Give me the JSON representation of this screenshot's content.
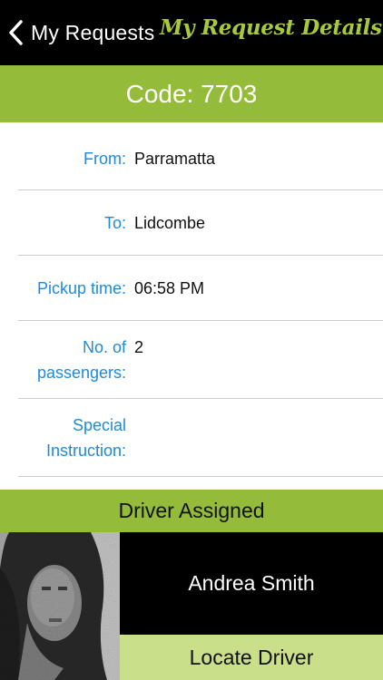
{
  "nav": {
    "back_label": "My Requests",
    "title": "My Request Details",
    "back_icon": "chevron-left-icon"
  },
  "code": {
    "text": "Code: 7703"
  },
  "details": {
    "from": {
      "label": "From:",
      "value": "Parramatta"
    },
    "to": {
      "label": "To:",
      "value": "Lidcombe"
    },
    "pickup": {
      "label": "Pickup time:",
      "value": "06:58 PM"
    },
    "passengers": {
      "label_line1": "No. of",
      "label_line2": "passengers:",
      "value": "2"
    },
    "special": {
      "label_line1": "Special",
      "label_line2": "Instruction:",
      "value": ""
    }
  },
  "driver": {
    "header": "Driver Assigned",
    "name": "Andrea Smith",
    "locate_label": "Locate Driver"
  },
  "colors": {
    "accent_green": "#95bb3b",
    "title_green": "#a7c93b",
    "label_blue": "#1f8ad8",
    "locate_green": "#c9df8a"
  }
}
